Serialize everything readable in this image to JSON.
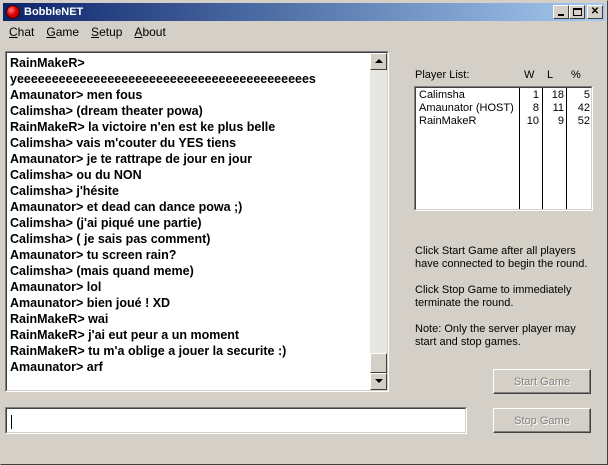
{
  "window": {
    "title": "BobbleNET"
  },
  "menu": [
    {
      "underline": "C",
      "rest": "hat"
    },
    {
      "underline": "G",
      "rest": "ame"
    },
    {
      "underline": "S",
      "rest": "etup"
    },
    {
      "underline": "A",
      "rest": "bout"
    }
  ],
  "chat": {
    "lines": [
      "RainMakeR>",
      "yeeeeeeeeeeeeeeeeeeeeeeeeeeeeeeeeeeeeeeeeees",
      "Amaunator>  men fous",
      "Calimsha>  (dream theater powa)",
      "RainMakeR>  la victoire n'en est ke plus belle",
      "Calimsha>  vais m'couter du YES tiens",
      "Amaunator>  je te rattrape de jour en jour",
      "Calimsha>  ou du NON",
      "Calimsha>  j'hésite",
      "Amaunator>  et dead can dance powa ;)",
      "Calimsha>  (j'ai piqué une partie)",
      "Calimsha>  ( je sais pas comment)",
      "Amaunator>  tu screen rain?",
      "Calimsha>  (mais quand meme)",
      "Amaunator>  lol",
      "Amaunator>  bien joué ! XD",
      "RainMakeR>  wai",
      "RainMakeR>  j'ai eut peur a un moment",
      "RainMakeR>  tu m'a oblige a jouer la securite :)",
      "Amaunator>  arf"
    ],
    "input_value": ""
  },
  "players": {
    "label": "Player List:",
    "headers": {
      "w": "W",
      "l": "L",
      "pct": "%"
    },
    "rows": [
      {
        "name": "Calimsha",
        "w": "1",
        "l": "18",
        "pct": "5"
      },
      {
        "name": "Amaunator (HOST)",
        "w": "8",
        "l": "11",
        "pct": "42"
      },
      {
        "name": "RainMakeR",
        "w": "10",
        "l": "9",
        "pct": "52"
      }
    ]
  },
  "help": {
    "start": "Click Start Game after all players have connected to begin the round.",
    "stop": "Click Stop Game to immediately terminate the round.",
    "note": "Note: Only the server player may start and stop games."
  },
  "buttons": {
    "start": "Start Game",
    "stop": "Stop Game"
  }
}
